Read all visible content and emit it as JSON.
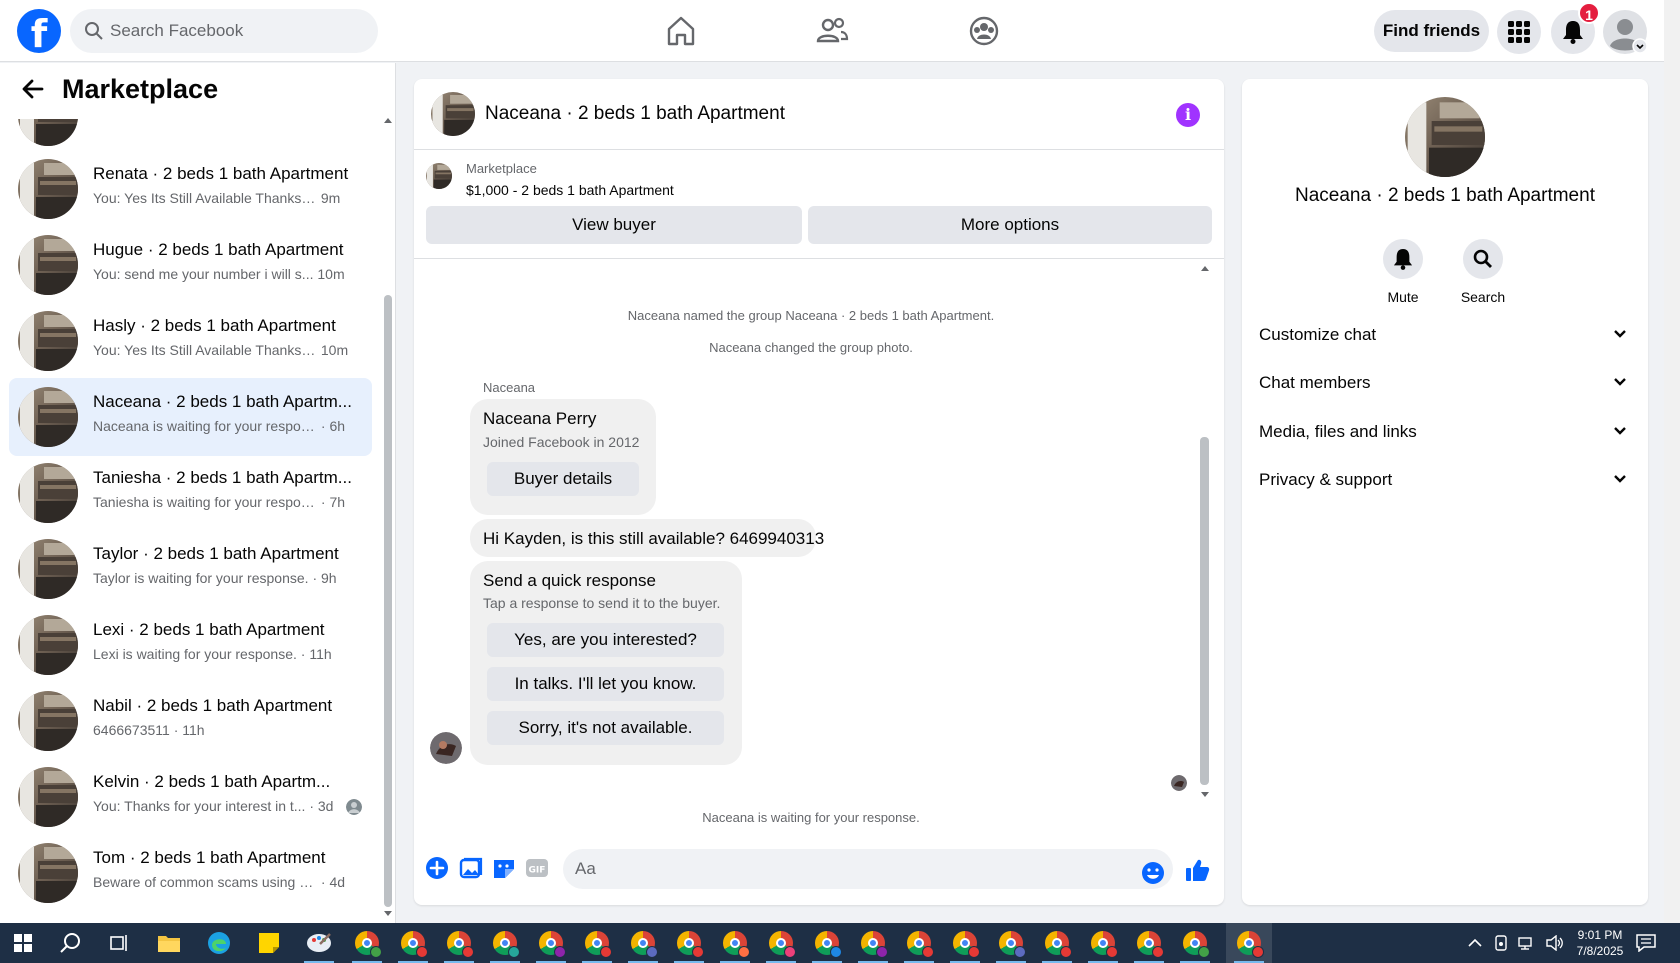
{
  "header": {
    "search_placeholder": "Search Facebook",
    "find_friends_label": "Find friends",
    "notification_count": "1"
  },
  "sidebar": {
    "title": "Marketplace",
    "conversations": [
      {
        "title": "Renata · 2 beds 1 bath Apartment",
        "preview": "You: Yes Its Still Available Thanks fo...",
        "time": "9m"
      },
      {
        "title": "Hugue · 2 beds 1 bath Apartment",
        "preview": "You: send me your number i will s...",
        "time": "10m"
      },
      {
        "title": "Hasly · 2 beds 1 bath Apartment",
        "preview": "You: Yes Its Still Available Thanks f...",
        "time": "10m"
      },
      {
        "title": "Naceana · 2 beds 1 bath Apartm...",
        "preview": "Naceana is waiting for your respon...",
        "time": "· 6h"
      },
      {
        "title": "Taniesha · 2 beds 1 bath Apartm...",
        "preview": "Taniesha is waiting for your respon...",
        "time": "· 7h"
      },
      {
        "title": "Taylor · 2 beds 1 bath Apartment",
        "preview": "Taylor is waiting for your response.",
        "time": "· 9h"
      },
      {
        "title": "Lexi · 2 beds 1 bath Apartment",
        "preview": "Lexi is waiting for your response.",
        "time": "· 11h"
      },
      {
        "title": "Nabil · 2 beds 1 bath Apartment",
        "preview": "6466673511",
        "time": "· 11h"
      },
      {
        "title": "Kelvin · 2 beds 1 bath Apartm...",
        "preview": "You: Thanks for your interest in t...",
        "time": "· 3d"
      },
      {
        "title": "Tom · 2 beds 1 bath Apartment",
        "preview": "Beware of common scams using pa...",
        "time": "· 4d"
      }
    ]
  },
  "chat": {
    "title": "Naceana · 2 beds 1 bath Apartment",
    "listing_source": "Marketplace",
    "listing_desc": "$1,000 - 2 beds 1 bath Apartment",
    "view_buyer_label": "View buyer",
    "more_options_label": "More options",
    "system_msg_1": "Naceana named the group Naceana · 2 beds 1 bath Apartment.",
    "system_msg_2": "Naceana changed the group photo.",
    "sender_name": "Naceana",
    "buyer_card": {
      "name": "Naceana Perry",
      "joined": "Joined Facebook in 2012",
      "button": "Buyer details"
    },
    "message_text": "Hi Kayden, is this still available? 6469940313",
    "quick": {
      "title": "Send a quick response",
      "subtitle": "Tap a response to send it to the buyer.",
      "options": [
        "Yes, are you interested?",
        "In talks. I'll let you know.",
        "Sorry, it's not available."
      ]
    },
    "waiting_text": "Naceana is waiting for your response.",
    "composer_placeholder": "Aa"
  },
  "right_panel": {
    "title": "Naceana · 2 beds 1 bath Apartment",
    "mute_label": "Mute",
    "search_label": "Search",
    "sections": [
      "Customize chat",
      "Chat members",
      "Media, files and links",
      "Privacy & support"
    ]
  },
  "taskbar": {
    "time": "9:01 PM",
    "date": "7/8/2025"
  },
  "colors": {
    "brand": "#0866ff",
    "accent_purple": "#a033ff",
    "active_row": "#e7f0fd",
    "taskbar": "#1e2f45"
  }
}
